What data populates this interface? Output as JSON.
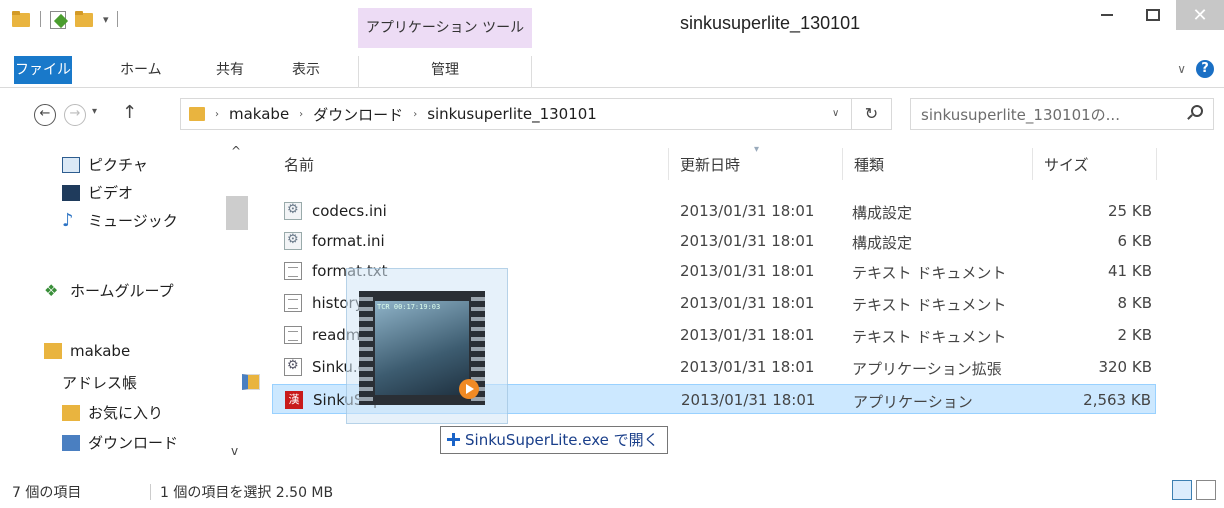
{
  "window": {
    "title": "sinkusuperlite_130101",
    "context_tab": "アプリケーション ツール",
    "qat_dropdown": "▾",
    "minimize": "",
    "close": "✕"
  },
  "ribbon": {
    "file": "ファイル",
    "home": "ホーム",
    "share": "共有",
    "view": "表示",
    "manage": "管理",
    "expand": "∨",
    "help": "?"
  },
  "nav": {
    "back": "←",
    "forward": "→",
    "recent": "▾",
    "up": "↑",
    "breadcrumb": [
      "makabe",
      "ダウンロード",
      "sinkusuperlite_130101"
    ],
    "crumb_sep": "›",
    "address_dropdown": "∨",
    "refresh": "↻",
    "search_placeholder": "sinkusuperlite_130101の..."
  },
  "nav_pane": {
    "items": [
      {
        "label": "ピクチャ",
        "icon": "pictures-icon"
      },
      {
        "label": "ビデオ",
        "icon": "videos-icon"
      },
      {
        "label": "ミュージック",
        "icon": "music-icon"
      },
      {
        "label": "ホームグループ",
        "icon": "homegroup-icon"
      },
      {
        "label": "makabe",
        "icon": "user-folder-icon"
      },
      {
        "label": "アドレス帳",
        "icon": "contacts-icon"
      },
      {
        "label": "お気に入り",
        "icon": "favorites-icon"
      },
      {
        "label": "ダウンロード",
        "icon": "downloads-icon"
      }
    ],
    "scroll_up": "^",
    "scroll_down": "v"
  },
  "columns": {
    "name": "名前",
    "modified": "更新日時",
    "type": "種類",
    "size": "サイズ"
  },
  "files": [
    {
      "name": "codecs.ini",
      "date": "2013/01/31 18:01",
      "type": "構成設定",
      "size": "25 KB",
      "icon": "ini"
    },
    {
      "name": "format.ini",
      "date": "2013/01/31 18:01",
      "type": "構成設定",
      "size": "6 KB",
      "icon": "ini"
    },
    {
      "name": "format.txt",
      "date": "2013/01/31 18:01",
      "type": "テキスト ドキュメント",
      "size": "41 KB",
      "icon": "txt"
    },
    {
      "name": "history.txt",
      "date": "2013/01/31 18:01",
      "type": "テキスト ドキュメント",
      "size": "8 KB",
      "icon": "txt"
    },
    {
      "name": "readme.txt",
      "date": "2013/01/31 18:01",
      "type": "テキスト ドキュメント",
      "size": "2 KB",
      "icon": "txt"
    },
    {
      "name": "Sinku.dll",
      "date": "2013/01/31 18:01",
      "type": "アプリケーション拡張",
      "size": "320 KB",
      "icon": "dll"
    },
    {
      "name": "SinkuSuperLite.exe",
      "date": "2013/01/31 18:01",
      "type": "アプリケーション",
      "size": "2,563 KB",
      "icon": "exe",
      "selected": true
    }
  ],
  "drag_ghost": {
    "hud": "TCR 00:17:19:03",
    "tooltip": "SinkuSuperLite.exe で開く"
  },
  "status": {
    "items": "7 個の項目",
    "selected": "1 個の項目を選択  2.50 MB"
  }
}
